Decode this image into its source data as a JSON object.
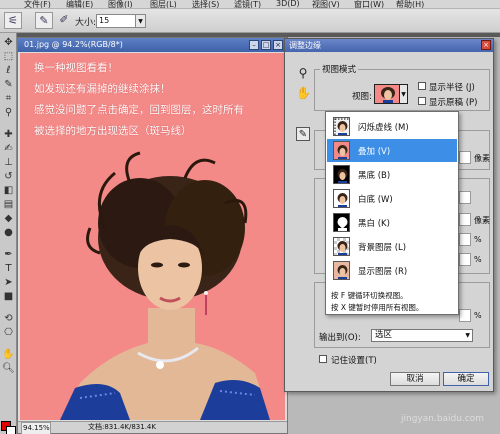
{
  "menu": {
    "items": [
      "文件(F)",
      "编辑(E)",
      "图像(I)",
      "图层(L)",
      "选择(S)",
      "滤镜(T)",
      "3D(D)",
      "视图(V)",
      "窗口(W)",
      "帮助(H)"
    ]
  },
  "options_bar": {
    "size_label": "大小:",
    "size_value": "15"
  },
  "document": {
    "title": "01.jpg @ 94.2%(RGB/8*)",
    "overlay_lines": [
      "换一种视图看看！",
      "如发现还有漏掉的继续涂抹！",
      "感觉没问题了点击确定，回到图层，这时所有",
      "被选择的地方出现选区（斑马线）"
    ],
    "zoom": "94.15%",
    "doc_info": "文档:831.4K/831.4K"
  },
  "dialog": {
    "title": "调整边缘",
    "view_mode_group": "视图模式",
    "view_label": "视图:",
    "show_radius": "显示半径 (J)",
    "show_original": "显示原稿 (P)",
    "px_unit": "像素",
    "pct_unit": "%",
    "view_modes": [
      {
        "label": "闪烁虚线 (M)",
        "icon": "marching-ants",
        "selected": false
      },
      {
        "label": "叠加 (V)",
        "icon": "overlay",
        "selected": true
      },
      {
        "label": "黑底 (B)",
        "icon": "on-black",
        "selected": false
      },
      {
        "label": "白底 (W)",
        "icon": "on-white",
        "selected": false
      },
      {
        "label": "黑白 (K)",
        "icon": "black-white",
        "selected": false
      },
      {
        "label": "背景图层 (L)",
        "icon": "on-layers",
        "selected": false
      },
      {
        "label": "显示图层 (R)",
        "icon": "reveal-layer",
        "selected": false
      }
    ],
    "hint_f": "按 F 键循环切换视图。",
    "hint_x": "按 X 键暂时停用所有视图。",
    "output_label": "输出到(O):",
    "output_value": "选区",
    "remember_label": "记住设置(T)",
    "cancel_label": "取消",
    "ok_label": "确定"
  },
  "watermark": "jingyan.baidu.com",
  "colors": {
    "canvas_background": "#f38a88",
    "foreground_swatch": "#e00000",
    "selection_highlight": "#3d8ee6"
  }
}
